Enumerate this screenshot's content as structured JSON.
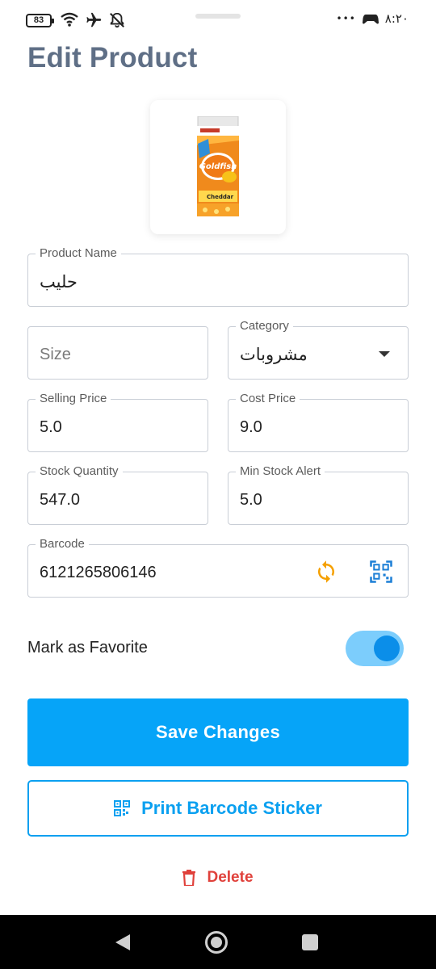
{
  "status_bar": {
    "battery_level": "83",
    "time": "٨:٢٠",
    "overflow": "•••"
  },
  "page": {
    "title": "Edit Product"
  },
  "product_image": {
    "icon": "product-photo-icon"
  },
  "fields": {
    "product_name": {
      "label": "Product Name",
      "value": "حليب"
    },
    "size": {
      "label": "",
      "placeholder": "Size",
      "value": ""
    },
    "category": {
      "label": "Category",
      "value": "مشروبات"
    },
    "selling_price": {
      "label": "Selling Price",
      "value": "5.0"
    },
    "cost_price": {
      "label": "Cost Price",
      "value": "9.0"
    },
    "stock_quantity": {
      "label": "Stock Quantity",
      "value": "547.0"
    },
    "min_stock_alert": {
      "label": "Min Stock Alert",
      "value": "5.0"
    },
    "barcode": {
      "label": "Barcode",
      "value": "6121265806146"
    }
  },
  "favorite": {
    "label": "Mark as Favorite",
    "enabled": true
  },
  "actions": {
    "save_label": "Save Changes",
    "print_label": "Print Barcode Sticker",
    "delete_label": "Delete"
  },
  "colors": {
    "accent": "#06a4f8",
    "title": "#5f6f86",
    "delete": "#e0413b",
    "refresh_icon": "#f5a000",
    "toggle_track": "#7ccdfc",
    "toggle_knob": "#0b8ee9"
  }
}
